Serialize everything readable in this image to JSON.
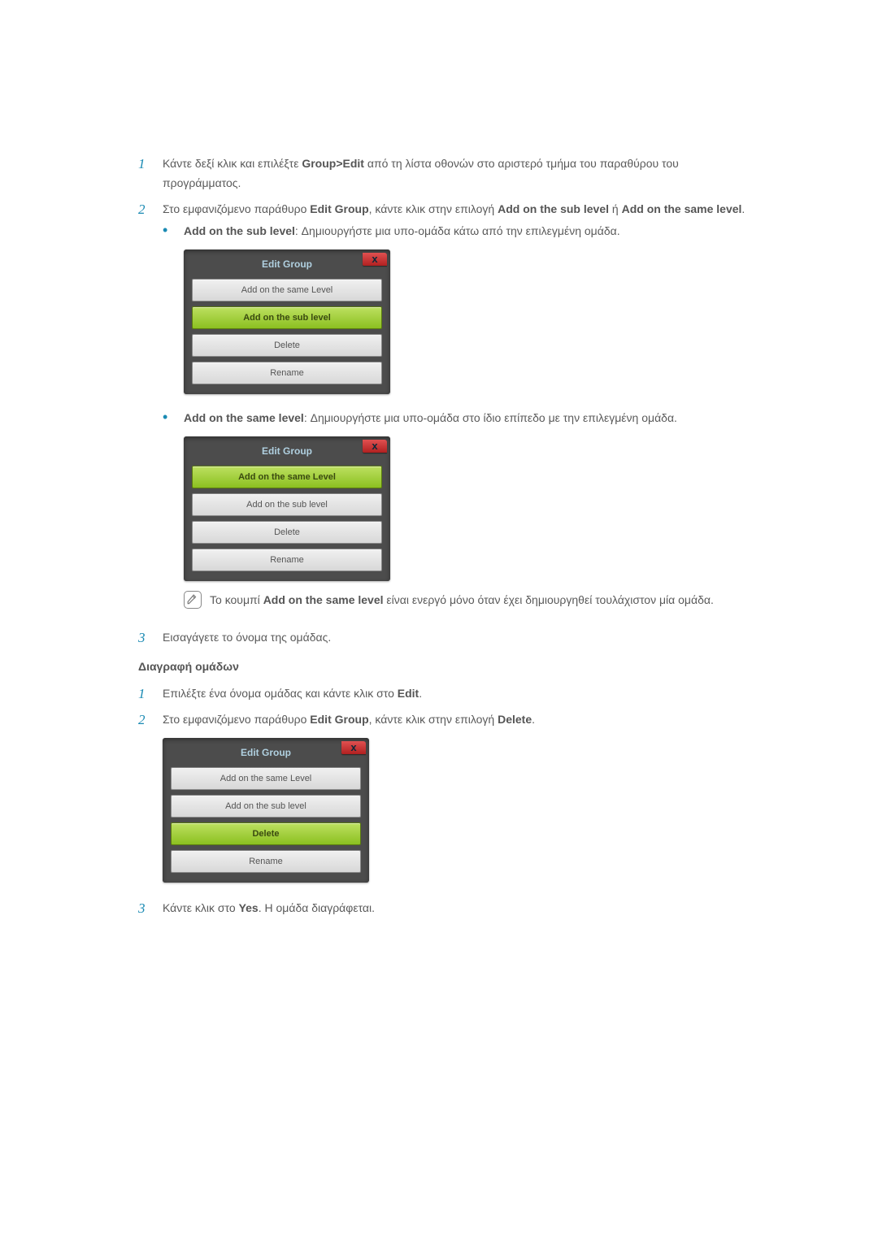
{
  "step1": {
    "pre": "Κάντε δεξί κλικ και επιλέξτε ",
    "bold": "Group>Edit",
    "post": " από τη λίστα οθονών στο αριστερό τμήμα του παραθύρου του προγράμματος."
  },
  "step2": {
    "pre": "Στο εμφανιζόμενο παράθυρο ",
    "b1": "Edit Group",
    "mid1": ", κάντε κλικ στην επιλογή ",
    "b2": "Add on the sub level",
    "mid2": " ή ",
    "b3": "Add on the same level",
    "post": "."
  },
  "bullet_sub": {
    "b": "Add on the sub level",
    "post": ": Δημιουργήστε μια υπο-ομάδα κάτω από την επιλεγμένη ομάδα."
  },
  "bullet_same": {
    "b": "Add on the same level",
    "post": ": Δημιουργήστε μια υπο-ομάδα στο ίδιο επίπεδο με την επιλεγμένη ομάδα."
  },
  "dialog": {
    "title": "Edit Group",
    "close": "x",
    "same": "Add on the same Level",
    "sub": "Add on the sub level",
    "delete": "Delete",
    "rename": "Rename"
  },
  "note": {
    "pre": "Το κουμπί ",
    "b": "Add on the same level",
    "post": " είναι ενεργό μόνο όταν έχει δημιουργηθεί τουλάχιστον μία ομάδα."
  },
  "step3": "Εισαγάγετε το όνομα της ομάδας.",
  "subhead": "Διαγραφή ομάδων",
  "del1": {
    "pre": "Επιλέξτε ένα όνομα ομάδας και κάντε κλικ στο ",
    "b": "Edit",
    "post": "."
  },
  "del2": {
    "pre": "Στο εμφανιζόμενο παράθυρο ",
    "b1": "Edit Group",
    "mid": ", κάντε κλικ στην επιλογή ",
    "b2": "Delete",
    "post": "."
  },
  "del3": {
    "pre": "Κάντε κλικ στο ",
    "b": "Yes",
    "post": ". Η ομάδα διαγράφεται."
  }
}
